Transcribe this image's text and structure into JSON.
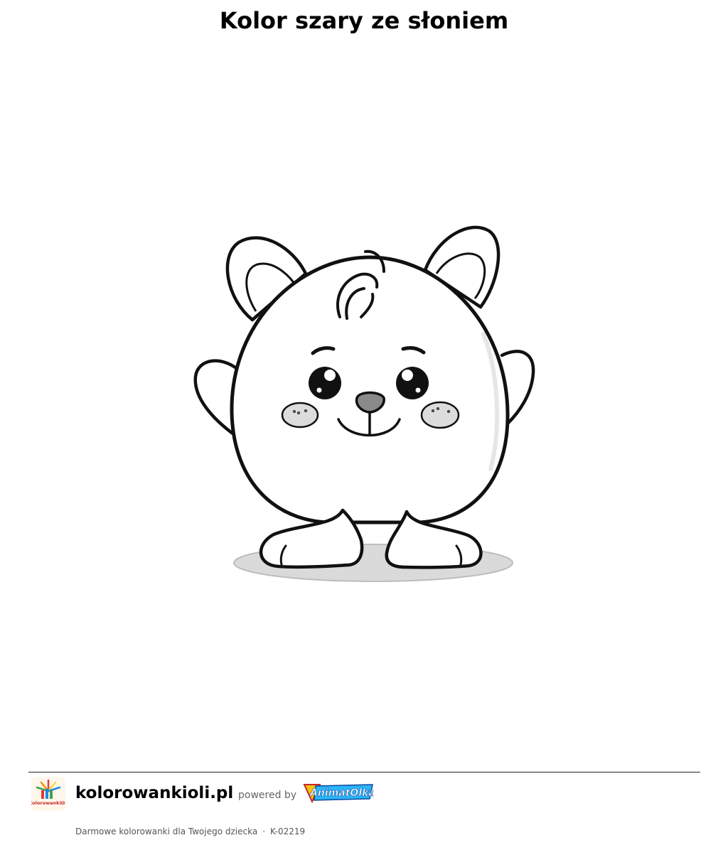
{
  "page": {
    "title": "Kolor szary ze słoniem"
  },
  "artwork": {
    "subject": "cartoon bear coloring page",
    "colors": {
      "outline": "#111111",
      "cheeks": "#dcdcdc",
      "nose": "#8a8a8a",
      "shadow": "#d8d8d8"
    }
  },
  "footer": {
    "logo_icon": "kolorowankioli-logo-icon",
    "logo_text": "KolorowankiOli",
    "site_name": "kolorowankioli.pl",
    "powered_by": "powered by",
    "partner_logo_text": "AnimatOlka",
    "tagline": "Darmowe kolorowanki dla Twojego dziecka",
    "separator": "·",
    "code": "K-02219"
  }
}
